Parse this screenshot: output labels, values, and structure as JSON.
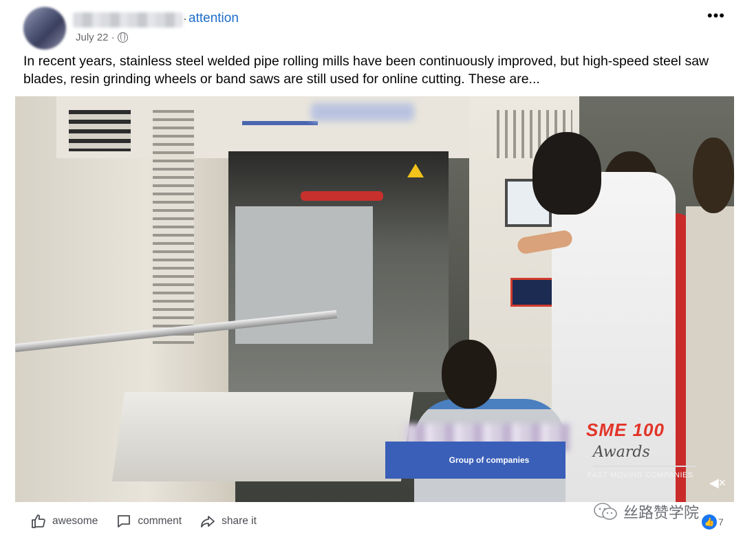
{
  "post": {
    "author_dot": "·",
    "follow_label": "attention",
    "date": "July 22 ·",
    "more_label": "•••",
    "text": "In recent years, stainless steel welded pipe rolling mills have been continuously improved, but high-speed steel saw blades, resin grinding wheels or band saws are still used for online cutting. These are..."
  },
  "video": {
    "overlay_caption": "Group of companies",
    "brand_logo": "SME 100",
    "brand_script": "Awards",
    "brand_sub": "FAST MOVING COMPANIES",
    "mute_glyph": "◀×"
  },
  "actions": [
    {
      "label": "awesome",
      "icon": "thumbs-up-icon"
    },
    {
      "label": "comment",
      "icon": "comment-icon"
    },
    {
      "label": "share it",
      "icon": "share-icon"
    }
  ],
  "watermark": "丝路赞学院",
  "reactions": {
    "icon": "like-icon",
    "count": "7"
  },
  "colors": {
    "link": "#1d6cc8",
    "overlay": "#3a5fb8",
    "brand": "#e23428",
    "like": "#1877f2"
  }
}
